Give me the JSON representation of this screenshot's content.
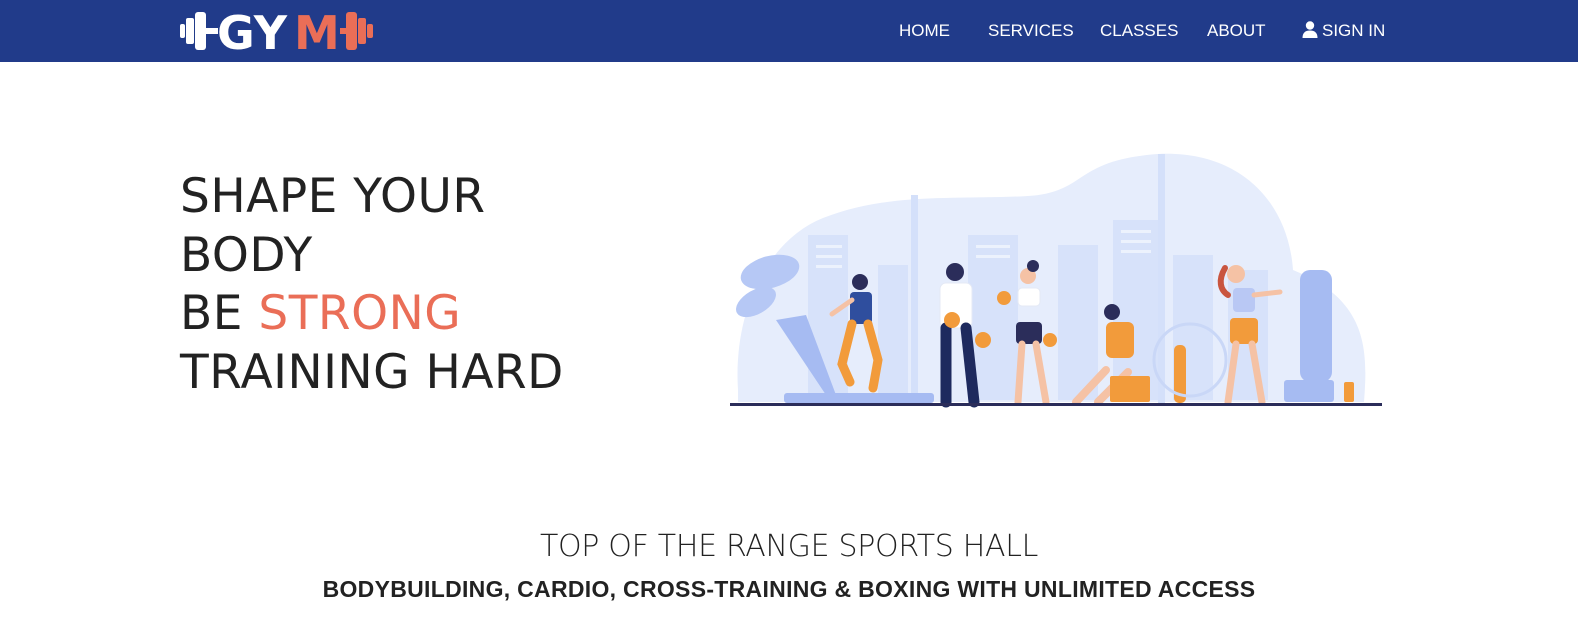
{
  "brand": {
    "logo_text_prefix": "GY",
    "logo_text_accent": "M",
    "colors": {
      "navbar": "#213b8a",
      "accent": "#ea6e57",
      "text": "#222222",
      "illustration_blue": "#dbe6fb"
    }
  },
  "nav": {
    "items": [
      {
        "label": "HOME"
      },
      {
        "label": "SERVICES"
      },
      {
        "label": "CLASSES"
      },
      {
        "label": "ABOUT"
      }
    ],
    "signin": {
      "label": "SIGN IN",
      "icon": "user-icon"
    }
  },
  "hero": {
    "line1": "SHAPE YOUR",
    "line2": "BODY",
    "line3_prefix": "BE ",
    "line3_accent": "STRONG",
    "line4": "TRAINING HARD",
    "illustration": "gym-illustration"
  },
  "section": {
    "title": "TOP OF THE RANGE SPORTS HALL",
    "subtitle": "BODYBUILDING, CARDIO, CROSS-TRAINING & BOXING WITH UNLIMITED ACCESS"
  }
}
